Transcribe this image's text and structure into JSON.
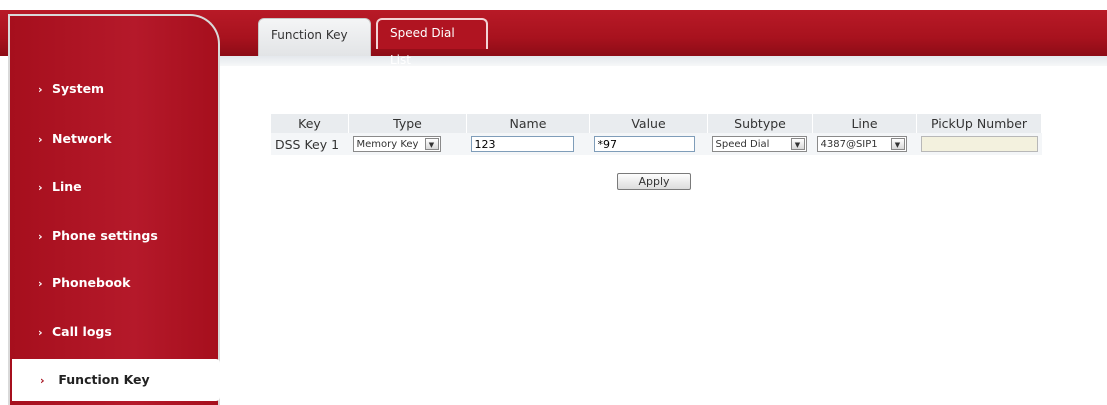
{
  "sidebar": {
    "items": [
      {
        "label": "System"
      },
      {
        "label": "Network"
      },
      {
        "label": "Line"
      },
      {
        "label": "Phone settings"
      },
      {
        "label": "Phonebook"
      },
      {
        "label": "Call logs"
      },
      {
        "label": "Function Key",
        "active": true
      }
    ]
  },
  "tabs": [
    {
      "label": "Function Key",
      "active": false
    },
    {
      "label": "Speed Dial List",
      "active": true
    }
  ],
  "table": {
    "headers": [
      "Key",
      "Type",
      "Name",
      "Value",
      "Subtype",
      "Line",
      "PickUp Number"
    ],
    "rows": [
      {
        "key": "DSS Key 1",
        "type": "Memory Key",
        "name": "123",
        "value": "*97",
        "subtype": "Speed Dial",
        "line": "4387@SIP1",
        "pickup": ""
      }
    ]
  },
  "apply_label": "Apply",
  "colors": {
    "brand_red": "#a8121e",
    "tab_active": "#b01421"
  }
}
